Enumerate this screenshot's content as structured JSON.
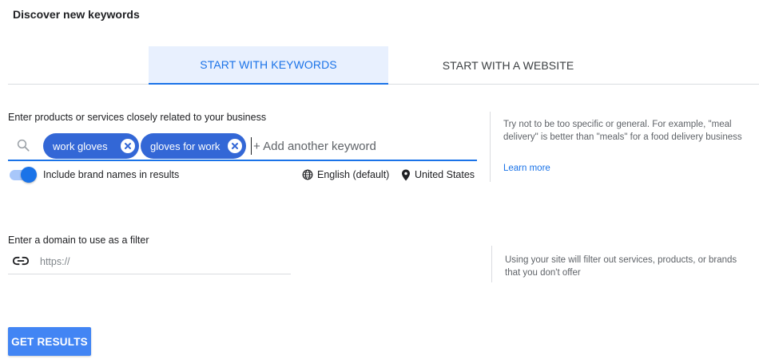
{
  "page": {
    "title": "Discover new keywords"
  },
  "tabs": [
    {
      "label": "START WITH KEYWORDS",
      "active": true
    },
    {
      "label": "START WITH A WEBSITE",
      "active": false
    }
  ],
  "keywords_section": {
    "label": "Enter products or services closely related to your business",
    "chips": [
      "work gloves",
      "gloves for work"
    ],
    "input_placeholder": "+ Add another keyword",
    "brand_toggle": {
      "label": "Include brand names in results",
      "on": true
    },
    "language": "English (default)",
    "location": "United States",
    "hint": "Try not to be too specific or general. For example, \"meal delivery\" is better than \"meals\" for a food delivery business",
    "learn_more": "Learn more"
  },
  "domain_section": {
    "label": "Enter a domain to use as a filter",
    "placeholder": "https://",
    "hint": "Using your site will filter out services, products, or brands that you don't offer"
  },
  "actions": {
    "get_results": "GET RESULTS"
  },
  "colors": {
    "accent": "#1a73e8",
    "chip": "#3367d6",
    "button": "#4285f4",
    "tab_active_bg": "#e8f0fe"
  }
}
